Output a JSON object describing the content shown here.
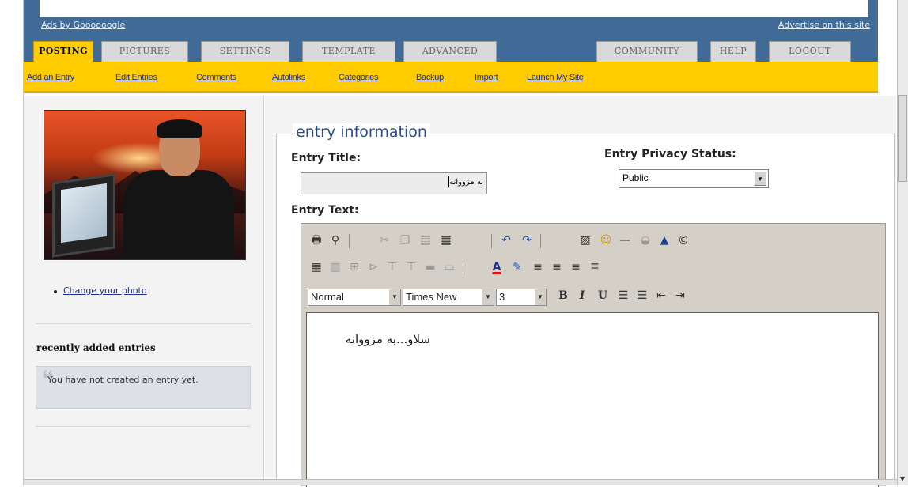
{
  "header": {
    "ads_text": "Ads by Goooooogle",
    "advertise_text": "Advertise on this site",
    "tabs_left": [
      "POSTING",
      "PICTURES",
      "SETTINGS",
      "TEMPLATE",
      "ADVANCED"
    ],
    "tabs_right": [
      "COMMUNITY",
      "HELP",
      "LOGOUT"
    ],
    "active_tab": "POSTING"
  },
  "subnav": [
    "Add an Entry",
    "Edit Entries",
    "Comments",
    "Autolinks",
    "Categories",
    "Backup",
    "Import",
    "Launch My Site"
  ],
  "sidebar": {
    "change_photo": "Change your photo",
    "recent_title": "recently added entries",
    "empty_message": "You have not created an entry yet."
  },
  "form": {
    "legend": "entry information",
    "title_label": "Entry Title:",
    "title_value": "به مزووانه",
    "privacy_label": "Entry Privacy Status:",
    "privacy_value": "Public",
    "text_label": "Entry Text:"
  },
  "editor": {
    "format_value": "Normal",
    "font_value": "Times New",
    "size_value": "3",
    "bold_label": "B",
    "italic_label": "I",
    "underline_label": "U",
    "content": "سلاو...به مزووانه"
  },
  "colors": {
    "header_blue": "#3f6b96",
    "nav_yellow": "#ffcc00",
    "link_blue": "#1f2f8f",
    "legend_blue": "#2b4c8c"
  }
}
